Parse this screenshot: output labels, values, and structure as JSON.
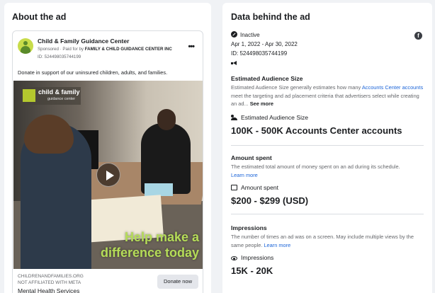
{
  "left_panel": {
    "title": "About the ad",
    "ad": {
      "advertiser": "Child & Family Guidance Center",
      "sponsored_prefix": "Sponsored · Paid for by ",
      "paid_by": "FAMILY & CHILD GUIDANCE CENTER INC",
      "id_text": "ID: 524498035744199",
      "more_icon": "more-horizontal-icon",
      "body": "Donate in support of our uninsured children, adults, and families.",
      "media": {
        "logo_line1": "child & family",
        "logo_line2": "guidance center",
        "overlay_line1": "Help make a",
        "overlay_line2": "difference today",
        "play_icon": "play-icon"
      },
      "cta": {
        "domain": "CHILDRENANDFAMILIES.ORG",
        "not_affiliated": "NOT AFFILIATED WITH META",
        "title": "Mental Health Services",
        "button": "Donate now"
      }
    }
  },
  "right_panel": {
    "title": "Data behind the ad",
    "status": "Inactive",
    "dates": "Apr 1, 2022 - Apr 30, 2022",
    "id_text": "ID: 524498035744199",
    "platform_icon": "facebook-icon",
    "audience": {
      "heading": "Estimated Audience Size",
      "desc_pre": "Estimated Audience Size generally estimates how many ",
      "desc_link": "Accounts Center accounts",
      "desc_post": " meet the targeting and ad placement criteria that advertisers select while creating an ad... ",
      "see_more": "See more",
      "label": "Estimated Audience Size",
      "value": "100K - 500K Accounts Center accounts"
    },
    "amount": {
      "heading": "Amount spent",
      "desc": "The estimated total amount of money spent on an ad during its schedule.",
      "learn_more": "Learn more",
      "label": "Amount spent",
      "value": "$200 - $299 (USD)"
    },
    "impressions": {
      "heading": "Impressions",
      "desc": "The number of times an ad was on a screen. May include multiple views by the same people.",
      "learn_more": "Learn more",
      "label": "Impressions",
      "value": "15K - 20K"
    }
  },
  "colors": {
    "link": "#1b64d8",
    "overlay_text": "#b5dc58",
    "logo_green": "#b4c82e"
  }
}
